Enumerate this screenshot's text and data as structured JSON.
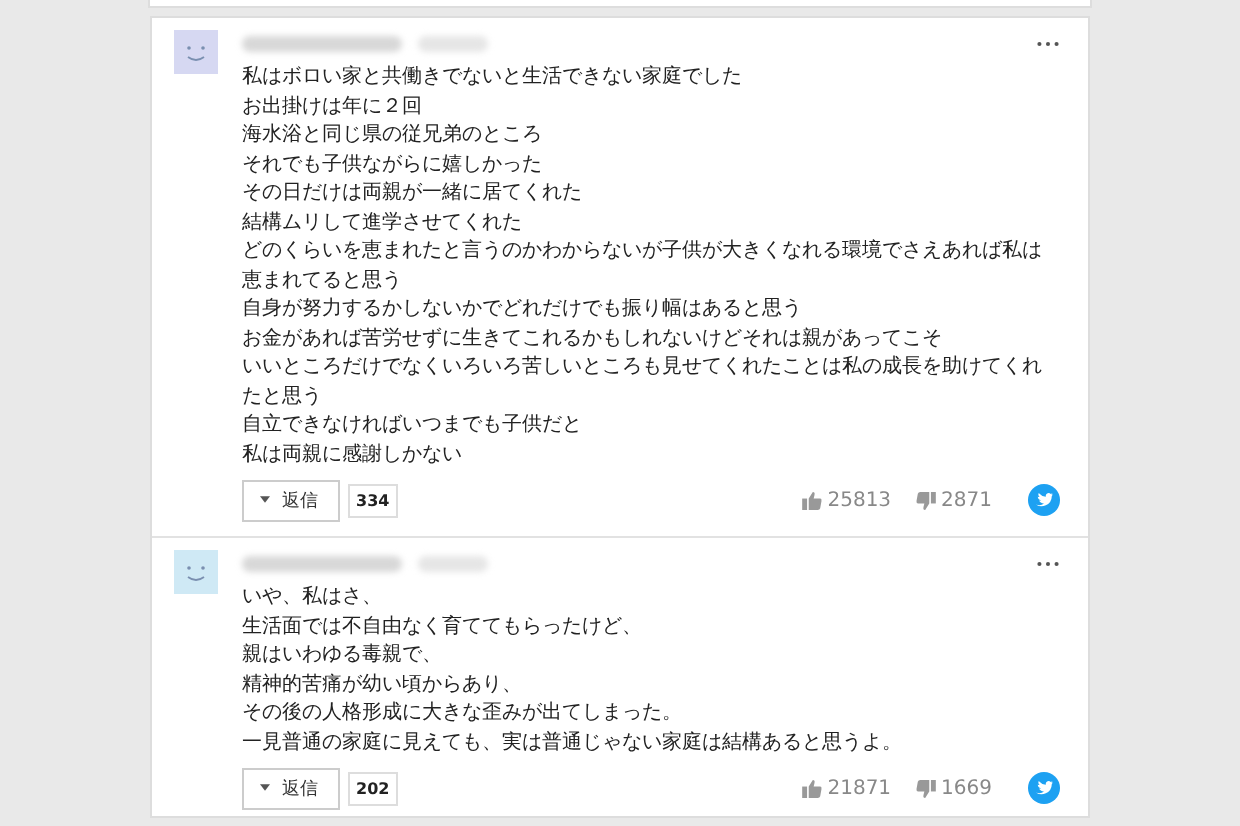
{
  "comments": [
    {
      "lines": [
        "私はボロい家と共働きでないと生活できない家庭でした",
        "お出掛けは年に２回",
        "海水浴と同じ県の従兄弟のところ",
        "それでも子供ながらに嬉しかった",
        "その日だけは両親が一緒に居てくれた",
        "結構ムリして進学させてくれた",
        "どのくらいを恵まれたと言うのかわからないが子供が大きくなれる環境でさえあれば私は恵まれてると思う",
        "自身が努力するかしないかでどれだけでも振り幅はあると思う",
        "お金があれば苦労せずに生きてこれるかもしれないけどそれは親があってこそ",
        "いいところだけでなくいろいろ苦しいところも見せてくれたことは私の成長を助けてくれたと思う",
        "自立できなければいつまでも子供だと",
        "私は両親に感謝しかない"
      ],
      "color": "#d6d8f2",
      "reply_label": "返信",
      "reply_count": "334",
      "likes": "25813",
      "dislikes": "2871"
    },
    {
      "lines": [
        "いや、私はさ、",
        "生活面では不自由なく育ててもらったけど、",
        "親はいわゆる毒親で、",
        "精神的苦痛が幼い頃からあり、",
        "その後の人格形成に大きな歪みが出てしまった。",
        "一見普通の家庭に見えても、実は普通じゃない家庭は結構あると思うよ。"
      ],
      "color": "#cfe9f5",
      "reply_label": "返信",
      "reply_count": "202",
      "likes": "21871",
      "dislikes": "1669"
    }
  ]
}
